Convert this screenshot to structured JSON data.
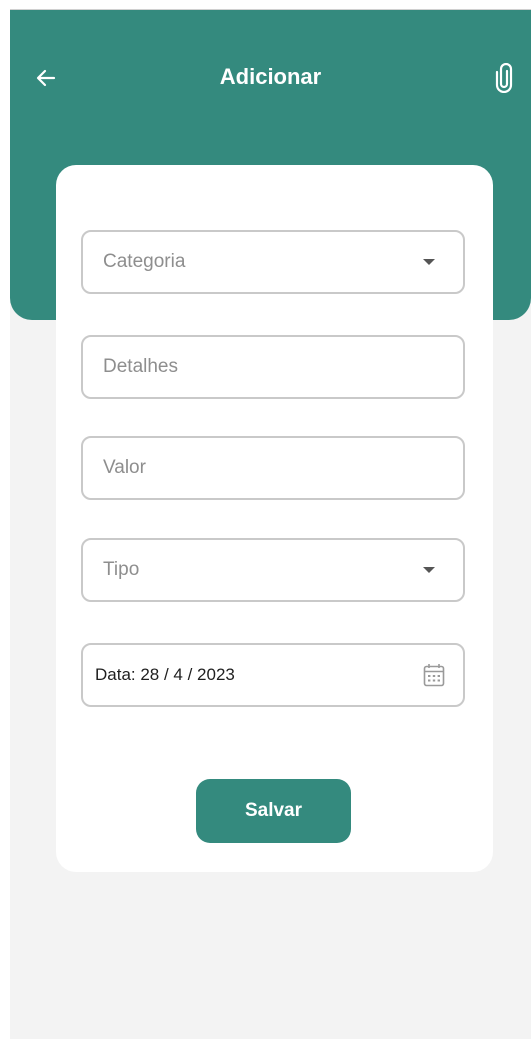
{
  "header": {
    "title": "Adicionar",
    "back_icon": "arrow-left-icon",
    "attach_icon": "paperclip-icon"
  },
  "form": {
    "categoria_placeholder": "Categoria",
    "detalhes_placeholder": "Detalhes",
    "valor_placeholder": "Valor",
    "tipo_placeholder": "Tipo",
    "date_label": "Data: 28 / 4 / 2023",
    "calendar_icon": "calendar-icon",
    "dropdown_icon": "caret-down-icon",
    "save_label": "Salvar"
  },
  "colors": {
    "primary": "#348a7e",
    "background": "#f3f3f3",
    "card": "#ffffff",
    "border": "#c9c9c9"
  }
}
